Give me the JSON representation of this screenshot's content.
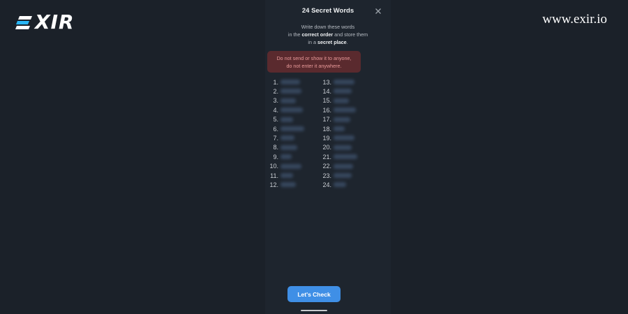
{
  "brand": {
    "logo_text": "XIR",
    "logo_icon": "exir-stripes-icon",
    "site_url": "www.exir.io"
  },
  "dialog": {
    "title": "24 Secret Words",
    "close_icon": "close-icon",
    "instructions": {
      "line1": "Write down these words",
      "line2_pre": "in the ",
      "line2_bold": "correct order",
      "line2_post": " and store them",
      "line3_pre": "in a ",
      "line3_bold": "secret place",
      "line3_post": "."
    },
    "warning": {
      "line1": "Do not send or show it to anyone,",
      "line2": "do not enter it anywhere."
    },
    "words": [
      {
        "num": "1."
      },
      {
        "num": "2."
      },
      {
        "num": "3."
      },
      {
        "num": "4."
      },
      {
        "num": "5."
      },
      {
        "num": "6."
      },
      {
        "num": "7."
      },
      {
        "num": "8."
      },
      {
        "num": "9."
      },
      {
        "num": "10."
      },
      {
        "num": "11."
      },
      {
        "num": "12."
      },
      {
        "num": "13."
      },
      {
        "num": "14."
      },
      {
        "num": "15."
      },
      {
        "num": "16."
      },
      {
        "num": "17."
      },
      {
        "num": "18."
      },
      {
        "num": "19."
      },
      {
        "num": "20."
      },
      {
        "num": "21."
      },
      {
        "num": "22."
      },
      {
        "num": "23."
      },
      {
        "num": "24."
      }
    ],
    "words_hidden": true,
    "check_button": "Let's Check"
  },
  "colors": {
    "background": "#1b2129",
    "warning_bg": "#5a2a2e",
    "warning_text": "#e99a9a",
    "accent": "#3f8fe6"
  }
}
